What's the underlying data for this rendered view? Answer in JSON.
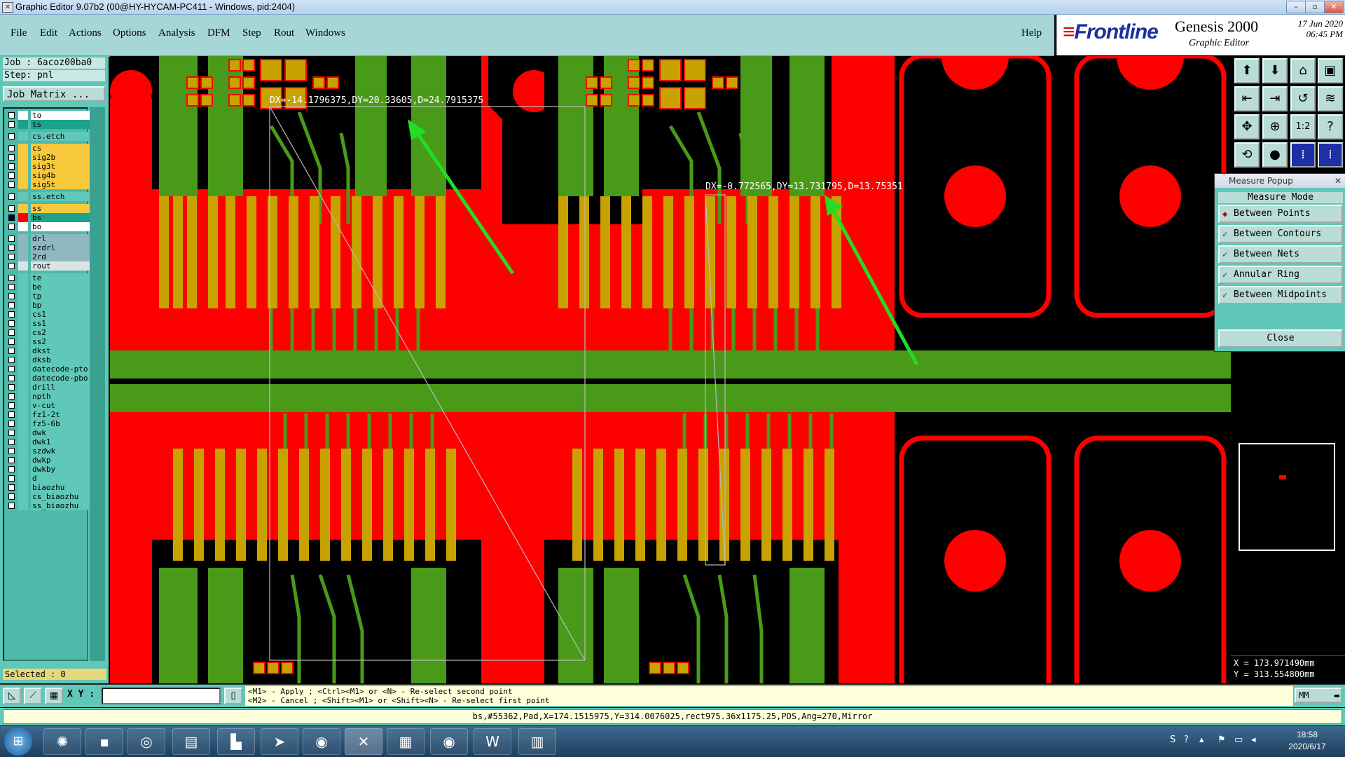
{
  "window": {
    "title": "Graphic Editor 9.07b2 (00@HY-HYCAM-PC411 - Windows, pid:2404)",
    "controls": [
      "–",
      "▫",
      "✕"
    ]
  },
  "menu": [
    "File",
    "Edit",
    "Actions",
    "Options",
    "Analysis",
    "DFM",
    "Step",
    "Rout",
    "Windows"
  ],
  "help": "Help",
  "brand": {
    "logo": "Frontline",
    "product": "Genesis 2000",
    "subtitle": "Graphic Editor",
    "date": "17 Jun 2020",
    "time": "06:45 PM"
  },
  "job": {
    "job": "Job : 6acoz00ba0",
    "step": "Step: pnl",
    "matrix_button": "Job Matrix ..."
  },
  "layers": [
    {
      "name": "to",
      "color": "#ffffff"
    },
    {
      "name": "ts",
      "color": "#1aa28a"
    },
    {
      "name": "cs.etch",
      "color": "#5fc8b8",
      "gap": true
    },
    {
      "name": "cs",
      "color": "#f8c93c",
      "gap": true
    },
    {
      "name": "sig2b",
      "color": "#f8c93c"
    },
    {
      "name": "sig3t",
      "color": "#f8c93c"
    },
    {
      "name": "sig4b",
      "color": "#f8c93c"
    },
    {
      "name": "sig5t",
      "color": "#f8c93c"
    },
    {
      "name": "ss.etch",
      "color": "#5fc8b8",
      "gap": true
    },
    {
      "name": "ss",
      "color": "#f8c93c",
      "gap": true
    },
    {
      "name": "bs",
      "color": "#1aa28a",
      "selected": true
    },
    {
      "name": "bo",
      "color": "#ffffff"
    },
    {
      "name": "drl",
      "color": "#8fb7bf",
      "gap": true
    },
    {
      "name": "szdrl",
      "color": "#8fb7bf"
    },
    {
      "name": "2rd",
      "color": "#8fb7bf"
    },
    {
      "name": "rout",
      "color": "#d9e4e4"
    },
    {
      "name": "te",
      "color": "#5fc8b8",
      "gap": true
    },
    {
      "name": "be",
      "color": "#5fc8b8"
    },
    {
      "name": "tp",
      "color": "#5fc8b8"
    },
    {
      "name": "bp",
      "color": "#5fc8b8"
    },
    {
      "name": "cs1",
      "color": "#5fc8b8"
    },
    {
      "name": "ss1",
      "color": "#5fc8b8"
    },
    {
      "name": "cs2",
      "color": "#5fc8b8"
    },
    {
      "name": "ss2",
      "color": "#5fc8b8"
    },
    {
      "name": "dkst",
      "color": "#5fc8b8"
    },
    {
      "name": "dksb",
      "color": "#5fc8b8"
    },
    {
      "name": "datecode-pto",
      "color": "#5fc8b8"
    },
    {
      "name": "datecode-pbo",
      "color": "#5fc8b8"
    },
    {
      "name": "drill",
      "color": "#5fc8b8"
    },
    {
      "name": "npth",
      "color": "#5fc8b8"
    },
    {
      "name": "v-cut",
      "color": "#5fc8b8"
    },
    {
      "name": "fz1-2t",
      "color": "#5fc8b8"
    },
    {
      "name": "fz5-6b",
      "color": "#5fc8b8"
    },
    {
      "name": "dwk",
      "color": "#5fc8b8"
    },
    {
      "name": "dwk1",
      "color": "#5fc8b8"
    },
    {
      "name": "szdwk",
      "color": "#5fc8b8"
    },
    {
      "name": "dwkp",
      "color": "#5fc8b8"
    },
    {
      "name": "dwkby",
      "color": "#5fc8b8"
    },
    {
      "name": "d",
      "color": "#5fc8b8"
    },
    {
      "name": "biaozhu",
      "color": "#5fc8b8"
    },
    {
      "name": "cs_biaozhu",
      "color": "#5fc8b8"
    },
    {
      "name": "ss_biaozhu",
      "color": "#5fc8b8"
    }
  ],
  "selected_count": "Selected : 0",
  "measurements": [
    "DX=-14.1796375,DY=20.33605,D=24.7915375",
    "DX=-0.772565,DY=13.731795,D=13.75351"
  ],
  "measure_popup": {
    "title": "Measure Popup",
    "mode_label": "Measure Mode",
    "modes": [
      {
        "label": "Between Points",
        "active": true
      },
      {
        "label": "Between Contours",
        "active": false
      },
      {
        "label": "Between Nets",
        "active": false
      },
      {
        "label": "Annular Ring",
        "active": false
      },
      {
        "label": "Between Midpoints",
        "active": false
      }
    ],
    "close": "Close"
  },
  "coords": {
    "x": "X = 173.971490mm",
    "y": "Y = 313.554800mm"
  },
  "xy_label": "X Y :",
  "hint": [
    "<M1> - Apply  ; <Ctrl><M1> or <N> - Re-select second point",
    "<M2> - Cancel ; <Shift><M1> or <Shift><N> - Re-select first point"
  ],
  "units_button": "MM",
  "status_line": "bs,#55362,Pad,X=174.1515975,Y=314.0076025,rect975.36x1175.25,POS,Ang=270,Mirror",
  "taskbar": {
    "time": "18:58",
    "date": "2020/6/17"
  },
  "colors": {
    "pad_red": "#ff0000",
    "trace_green": "#4a9a1a",
    "gold": "#c8a200",
    "arrow": "#22dd22"
  }
}
